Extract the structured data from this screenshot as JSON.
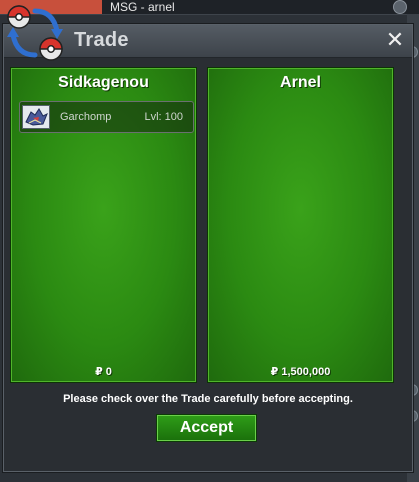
{
  "background_window": {
    "title": "MSG - arnel"
  },
  "dialog": {
    "title": "Trade",
    "close_glyph": "✕",
    "notice": "Please check over the Trade carefully before accepting.",
    "accept_label": "Accept"
  },
  "left_panel": {
    "name": "Sidkagenou",
    "money": "₽ 0",
    "items": [
      {
        "name": "Garchomp",
        "level": "Lvl: 100",
        "icon": "garchomp-sprite-icon"
      }
    ]
  },
  "right_panel": {
    "name": "Arnel",
    "money": "₽ 1,500,000",
    "items": []
  },
  "colors": {
    "panel_green": "#2b8a12",
    "accent_red": "#c8503c",
    "dialog_bg": "#2a2e33"
  }
}
